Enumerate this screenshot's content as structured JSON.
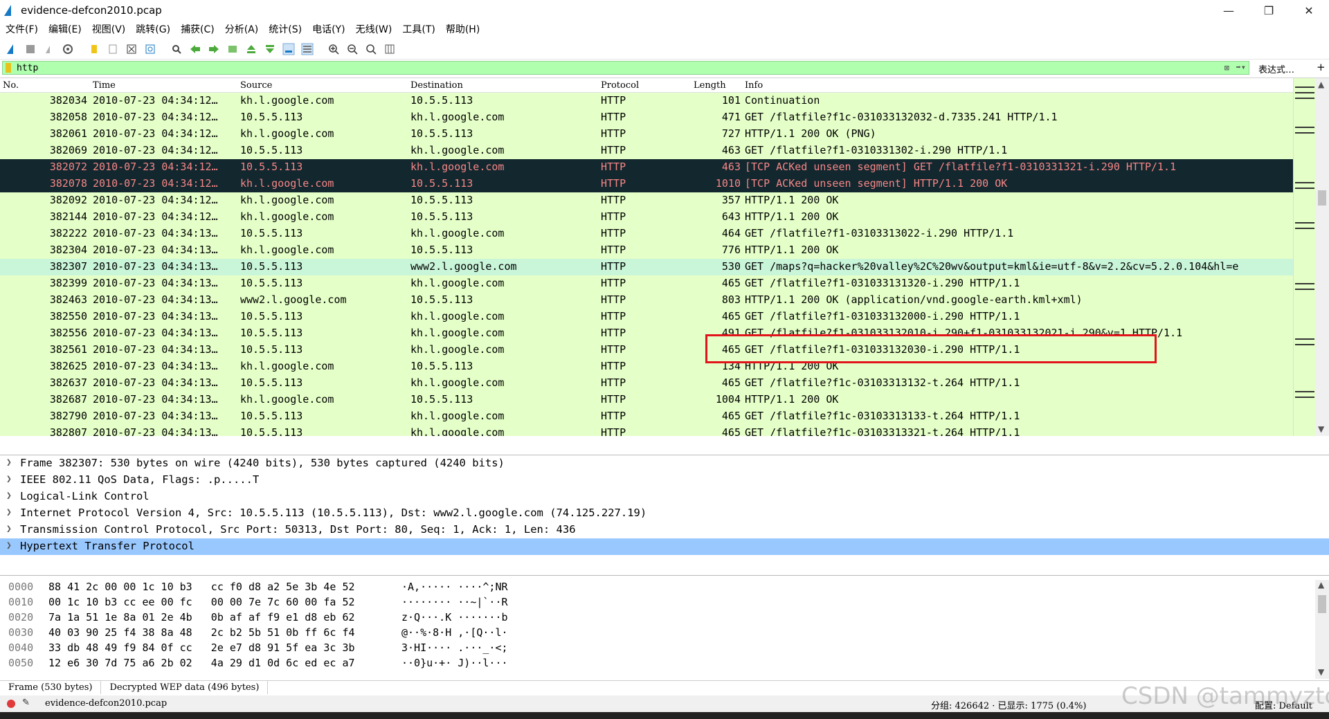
{
  "window": {
    "title": "evidence-defcon2010.pcap",
    "controls": {
      "minimize": "—",
      "maximize": "❐",
      "close": "✕"
    }
  },
  "menu": [
    "文件(F)",
    "编辑(E)",
    "视图(V)",
    "跳转(G)",
    "捕获(C)",
    "分析(A)",
    "统计(S)",
    "电话(Y)",
    "无线(W)",
    "工具(T)",
    "帮助(H)"
  ],
  "filter": {
    "value": "http",
    "expression_label": "表达式…",
    "add_label": "+"
  },
  "packet_list": {
    "columns": [
      "No.",
      "Time",
      "Source",
      "Destination",
      "Protocol",
      "Length",
      "Info"
    ],
    "rows": [
      {
        "no": "382034",
        "time": "2010-07-23 04:34:12…",
        "src": "kh.l.google.com",
        "dst": "10.5.5.113",
        "proto": "HTTP",
        "len": "101",
        "info": "Continuation",
        "style": "normal"
      },
      {
        "no": "382058",
        "time": "2010-07-23 04:34:12…",
        "src": "10.5.5.113",
        "dst": "kh.l.google.com",
        "proto": "HTTP",
        "len": "471",
        "info": "GET /flatfile?f1c-031033132032-d.7335.241 HTTP/1.1",
        "style": "normal"
      },
      {
        "no": "382061",
        "time": "2010-07-23 04:34:12…",
        "src": "kh.l.google.com",
        "dst": "10.5.5.113",
        "proto": "HTTP",
        "len": "727",
        "info": "HTTP/1.1 200 OK  (PNG)",
        "style": "normal"
      },
      {
        "no": "382069",
        "time": "2010-07-23 04:34:12…",
        "src": "10.5.5.113",
        "dst": "kh.l.google.com",
        "proto": "HTTP",
        "len": "463",
        "info": "GET /flatfile?f1-0310331302-i.290 HTTP/1.1",
        "style": "normal"
      },
      {
        "no": "382072",
        "time": "2010-07-23 04:34:12…",
        "src": "10.5.5.113",
        "dst": "kh.l.google.com",
        "proto": "HTTP",
        "len": "463",
        "info": "[TCP ACKed unseen segment] GET /flatfile?f1-0310331321-i.290 HTTP/1.1",
        "style": "dark"
      },
      {
        "no": "382078",
        "time": "2010-07-23 04:34:12…",
        "src": "kh.l.google.com",
        "dst": "10.5.5.113",
        "proto": "HTTP",
        "len": "1010",
        "info": "[TCP ACKed unseen segment] HTTP/1.1 200 OK",
        "style": "dark"
      },
      {
        "no": "382092",
        "time": "2010-07-23 04:34:12…",
        "src": "kh.l.google.com",
        "dst": "10.5.5.113",
        "proto": "HTTP",
        "len": "357",
        "info": "HTTP/1.1 200 OK",
        "style": "normal"
      },
      {
        "no": "382144",
        "time": "2010-07-23 04:34:12…",
        "src": "kh.l.google.com",
        "dst": "10.5.5.113",
        "proto": "HTTP",
        "len": "643",
        "info": "HTTP/1.1 200 OK",
        "style": "normal"
      },
      {
        "no": "382222",
        "time": "2010-07-23 04:34:13…",
        "src": "10.5.5.113",
        "dst": "kh.l.google.com",
        "proto": "HTTP",
        "len": "464",
        "info": "GET /flatfile?f1-03103313022-i.290 HTTP/1.1",
        "style": "normal"
      },
      {
        "no": "382304",
        "time": "2010-07-23 04:34:13…",
        "src": "kh.l.google.com",
        "dst": "10.5.5.113",
        "proto": "HTTP",
        "len": "776",
        "info": "HTTP/1.1 200 OK",
        "style": "normal"
      },
      {
        "no": "382307",
        "time": "2010-07-23 04:34:13…",
        "src": "10.5.5.113",
        "dst": "www2.l.google.com",
        "proto": "HTTP",
        "len": "530",
        "info": "GET /maps?q=hacker%20valley%2C%20wv&output=kml&ie=utf-8&v=2.2&cv=5.2.0.104&hl=e",
        "style": "selected"
      },
      {
        "no": "382399",
        "time": "2010-07-23 04:34:13…",
        "src": "10.5.5.113",
        "dst": "kh.l.google.com",
        "proto": "HTTP",
        "len": "465",
        "info": "GET /flatfile?f1-031033131320-i.290 HTTP/1.1",
        "style": "normal"
      },
      {
        "no": "382463",
        "time": "2010-07-23 04:34:13…",
        "src": "www2.l.google.com",
        "dst": "10.5.5.113",
        "proto": "HTTP",
        "len": "803",
        "info": "HTTP/1.1 200 OK  (application/vnd.google-earth.kml+xml)",
        "style": "normal"
      },
      {
        "no": "382550",
        "time": "2010-07-23 04:34:13…",
        "src": "10.5.5.113",
        "dst": "kh.l.google.com",
        "proto": "HTTP",
        "len": "465",
        "info": "GET /flatfile?f1-031033132000-i.290 HTTP/1.1",
        "style": "normal"
      },
      {
        "no": "382556",
        "time": "2010-07-23 04:34:13…",
        "src": "10.5.5.113",
        "dst": "kh.l.google.com",
        "proto": "HTTP",
        "len": "491",
        "info": "GET /flatfile?f1-031033132010-i.290+f1-031033132021-i.290&v=1 HTTP/1.1",
        "style": "normal"
      },
      {
        "no": "382561",
        "time": "2010-07-23 04:34:13…",
        "src": "10.5.5.113",
        "dst": "kh.l.google.com",
        "proto": "HTTP",
        "len": "465",
        "info": "GET /flatfile?f1-031033132030-i.290 HTTP/1.1",
        "style": "normal"
      },
      {
        "no": "382625",
        "time": "2010-07-23 04:34:13…",
        "src": "kh.l.google.com",
        "dst": "10.5.5.113",
        "proto": "HTTP",
        "len": "134",
        "info": "HTTP/1.1 200 OK",
        "style": "normal"
      },
      {
        "no": "382637",
        "time": "2010-07-23 04:34:13…",
        "src": "10.5.5.113",
        "dst": "kh.l.google.com",
        "proto": "HTTP",
        "len": "465",
        "info": "GET /flatfile?f1c-03103313132-t.264 HTTP/1.1",
        "style": "normal"
      },
      {
        "no": "382687",
        "time": "2010-07-23 04:34:13…",
        "src": "kh.l.google.com",
        "dst": "10.5.5.113",
        "proto": "HTTP",
        "len": "1004",
        "info": "HTTP/1.1 200 OK",
        "style": "normal"
      },
      {
        "no": "382790",
        "time": "2010-07-23 04:34:13…",
        "src": "10.5.5.113",
        "dst": "kh.l.google.com",
        "proto": "HTTP",
        "len": "465",
        "info": "GET /flatfile?f1c-03103313133-t.264 HTTP/1.1",
        "style": "normal"
      },
      {
        "no": "382807",
        "time": "2010-07-23 04:34:13…",
        "src": "10.5.5.113",
        "dst": "kh.l.google.com",
        "proto": "HTTP",
        "len": "465",
        "info": "GET /flatfile?f1c-03103313321-t.264 HTTP/1.1",
        "style": "normal"
      }
    ]
  },
  "details": [
    {
      "text": "Frame 382307: 530 bytes on wire (4240 bits), 530 bytes captured (4240 bits)",
      "selected": false
    },
    {
      "text": "IEEE 802.11 QoS Data, Flags: .p.....T",
      "selected": false
    },
    {
      "text": "Logical-Link Control",
      "selected": false
    },
    {
      "text": "Internet Protocol Version 4, Src: 10.5.5.113 (10.5.5.113), Dst: www2.l.google.com (74.125.227.19)",
      "selected": false
    },
    {
      "text": "Transmission Control Protocol, Src Port: 50313, Dst Port: 80, Seq: 1, Ack: 1, Len: 436",
      "selected": false
    },
    {
      "text": "Hypertext Transfer Protocol",
      "selected": true
    }
  ],
  "bytes": [
    {
      "offset": "0000",
      "hex": "88 41 2c 00 00 1c 10 b3   cc f0 d8 a2 5e 3b 4e 52",
      "ascii": "·A,····· ····^;NR"
    },
    {
      "offset": "0010",
      "hex": "00 1c 10 b3 cc ee 00 fc   00 00 7e 7c 60 00 fa 52",
      "ascii": "········ ··~|`··R"
    },
    {
      "offset": "0020",
      "hex": "7a 1a 51 1e 8a 01 2e 4b   0b af af f9 e1 d8 eb 62",
      "ascii": "z·Q···.K ·······b"
    },
    {
      "offset": "0030",
      "hex": "40 03 90 25 f4 38 8a 48   2c b2 5b 51 0b ff 6c f4",
      "ascii": "@··%·8·H ,·[Q··l·"
    },
    {
      "offset": "0040",
      "hex": "33 db 48 49 f9 84 0f cc   2e e7 d8 91 5f ea 3c 3b",
      "ascii": "3·HI···· .···_·<;"
    },
    {
      "offset": "0050",
      "hex": "12 e6 30 7d 75 a6 2b 02   4a 29 d1 0d 6c ed ec a7",
      "ascii": "··0}u·+· J)··l···"
    }
  ],
  "bytes_tabs": [
    "Frame (530 bytes)",
    "Decrypted WEP data (496 bytes)"
  ],
  "status": {
    "file": "evidence-defcon2010.pcap",
    "stats": "分组: 426642 · 已显示: 1775 (0.4%)",
    "profile": "配置: Default"
  },
  "watermark": "CSDN @tammyztc",
  "colors": {
    "row_bg": "#e4ffc7",
    "dark_row_bg": "#12272e",
    "dark_row_fg": "#f78787",
    "selected_row_bg": "#c9f5d9",
    "filter_bg": "#afffaf",
    "detail_selected_bg": "#99c8ff",
    "highlight_box": "#e3131b"
  }
}
